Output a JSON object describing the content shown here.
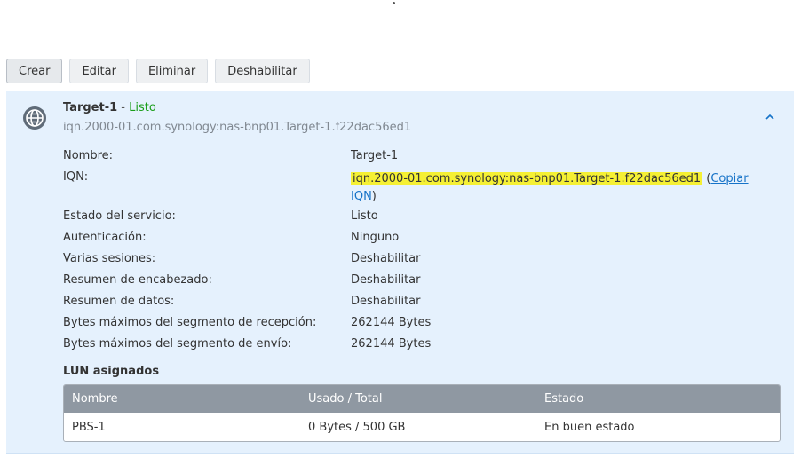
{
  "toolbar": {
    "create": "Crear",
    "edit": "Editar",
    "delete": "Eliminar",
    "disable": "Deshabilitar"
  },
  "target": {
    "name": "Target-1",
    "separator": " - ",
    "status": "Listo",
    "iqn_subtitle": "iqn.2000-01.com.synology:nas-bnp01.Target-1.f22dac56ed1",
    "icon": "globe-icon",
    "collapse_icon": "chevron-up-icon"
  },
  "details": {
    "name_label": "Nombre:",
    "name_value": "Target-1",
    "iqn_label": "IQN:",
    "iqn_value": "iqn.2000-01.com.synology:nas-bnp01.Target-1.f22dac56ed1",
    "copy_open": " (",
    "copy_link_part1": "Copiar",
    "copy_link_part2": "IQN",
    "copy_close": ")",
    "service_label": "Estado del servicio:",
    "service_value": "Listo",
    "auth_label": "Autenticación:",
    "auth_value": "Ninguno",
    "multi_label": "Varias sesiones:",
    "multi_value": "Deshabilitar",
    "header_digest_label": "Resumen de encabezado:",
    "header_digest_value": "Deshabilitar",
    "data_digest_label": "Resumen de datos:",
    "data_digest_value": "Deshabilitar",
    "max_recv_label": "Bytes máximos del segmento de recepción:",
    "max_recv_value": "262144 Bytes",
    "max_send_label": "Bytes máximos del segmento de envío:",
    "max_send_value": "262144 Bytes"
  },
  "lun": {
    "title": "LUN asignados",
    "columns": [
      "Nombre",
      "Usado / Total",
      "Estado"
    ],
    "rows": [
      {
        "name": "PBS-1",
        "usage": "0 Bytes / 500 GB",
        "status": "En buen estado"
      }
    ]
  },
  "colors": {
    "panel_bg": "#e5f1fd",
    "status_green": "#1a9e1a",
    "link": "#1673c8",
    "highlight": "#f5f034",
    "table_header": "#8f98a2"
  }
}
